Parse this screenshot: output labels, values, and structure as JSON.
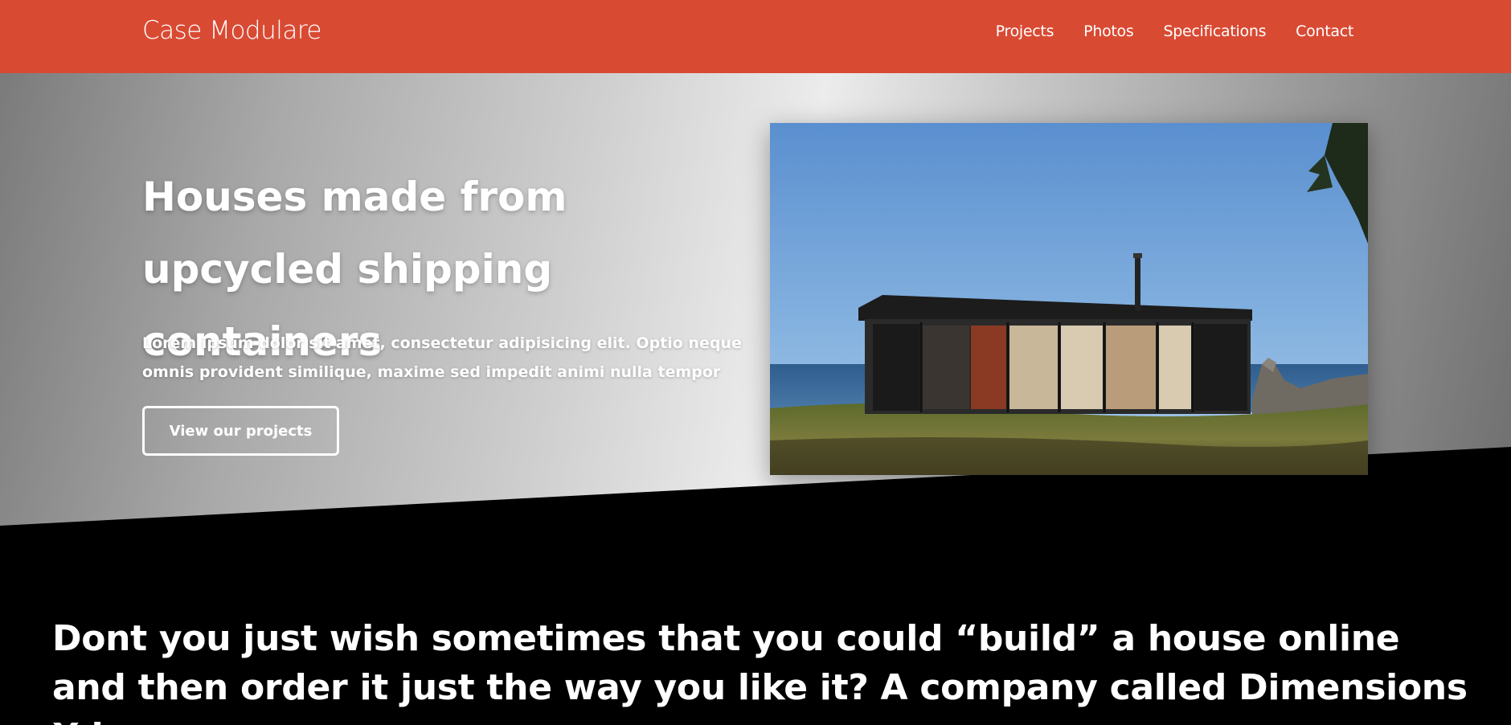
{
  "nav": {
    "brand": "Case Modulare",
    "items": [
      {
        "label": "Projects"
      },
      {
        "label": "Photos"
      },
      {
        "label": "Specifications"
      },
      {
        "label": "Contact"
      }
    ]
  },
  "hero": {
    "title": "Houses made from upcycled shipping containers",
    "lead": "Lorem ipsum dolor sit amet, consectetur adipisicing elit. Optio neque omnis provident similique, maxime sed impedit animi nulla tempor",
    "cta": "View our projects",
    "image_subject": "container-house-photo"
  },
  "article": {
    "text": "Dont you just wish sometimes that you could “build” a house online and then order it just the way you like it? A company called Dimensions X is"
  },
  "colors": {
    "nav_bg": "#d94a33",
    "page_bg": "#000000",
    "text": "#ffffff"
  }
}
